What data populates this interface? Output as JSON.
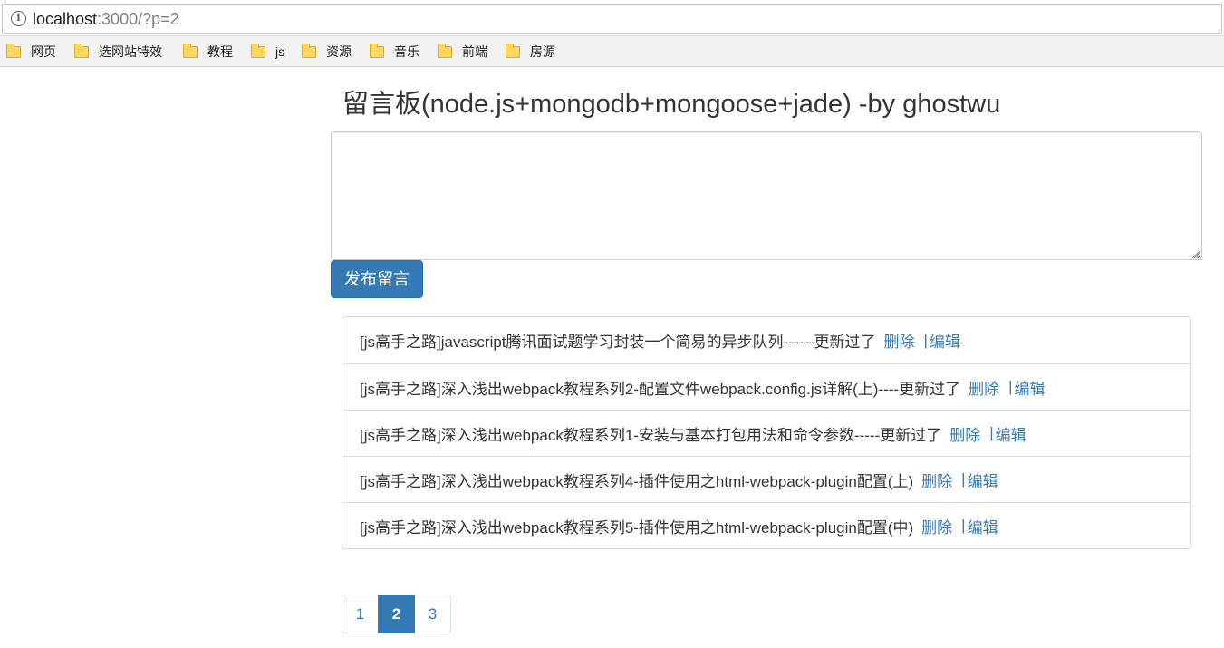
{
  "browser": {
    "url_host": "localhost",
    "url_rest": ":3000/?p=2",
    "bookmarks": [
      {
        "label": "网页"
      },
      {
        "label": "选网站特效"
      },
      {
        "label": "教程"
      },
      {
        "label": "js"
      },
      {
        "label": "资源"
      },
      {
        "label": "音乐"
      },
      {
        "label": "前端"
      },
      {
        "label": "房源"
      }
    ]
  },
  "page": {
    "title": "留言板(node.js+mongodb+mongoose+jade) -by ghostwu",
    "textarea_value": "",
    "publish_label": "发布留言"
  },
  "messages": [
    {
      "text": "[js高手之路]javascript腾讯面试题学习封装一个简易的异步队列------更新过了",
      "delete": "删除",
      "sep": "|",
      "edit": "编辑"
    },
    {
      "text": "[js高手之路]深入浅出webpack教程系列2-配置文件webpack.config.js详解(上)----更新过了",
      "delete": "删除",
      "sep": "|",
      "edit": "编辑"
    },
    {
      "text": "[js高手之路]深入浅出webpack教程系列1-安装与基本打包用法和命令参数-----更新过了",
      "delete": "删除",
      "sep": "|",
      "edit": "编辑"
    },
    {
      "text": "[js高手之路]深入浅出webpack教程系列4-插件使用之html-webpack-plugin配置(上)",
      "delete": "删除",
      "sep": "|",
      "edit": "编辑"
    },
    {
      "text": "[js高手之路]深入浅出webpack教程系列5-插件使用之html-webpack-plugin配置(中)",
      "delete": "删除",
      "sep": "|",
      "edit": "编辑"
    }
  ],
  "pagination": {
    "pages": [
      "1",
      "2",
      "3"
    ],
    "current": "2"
  },
  "colors": {
    "primary": "#337ab7",
    "border": "#dddddd",
    "text": "#333333"
  }
}
